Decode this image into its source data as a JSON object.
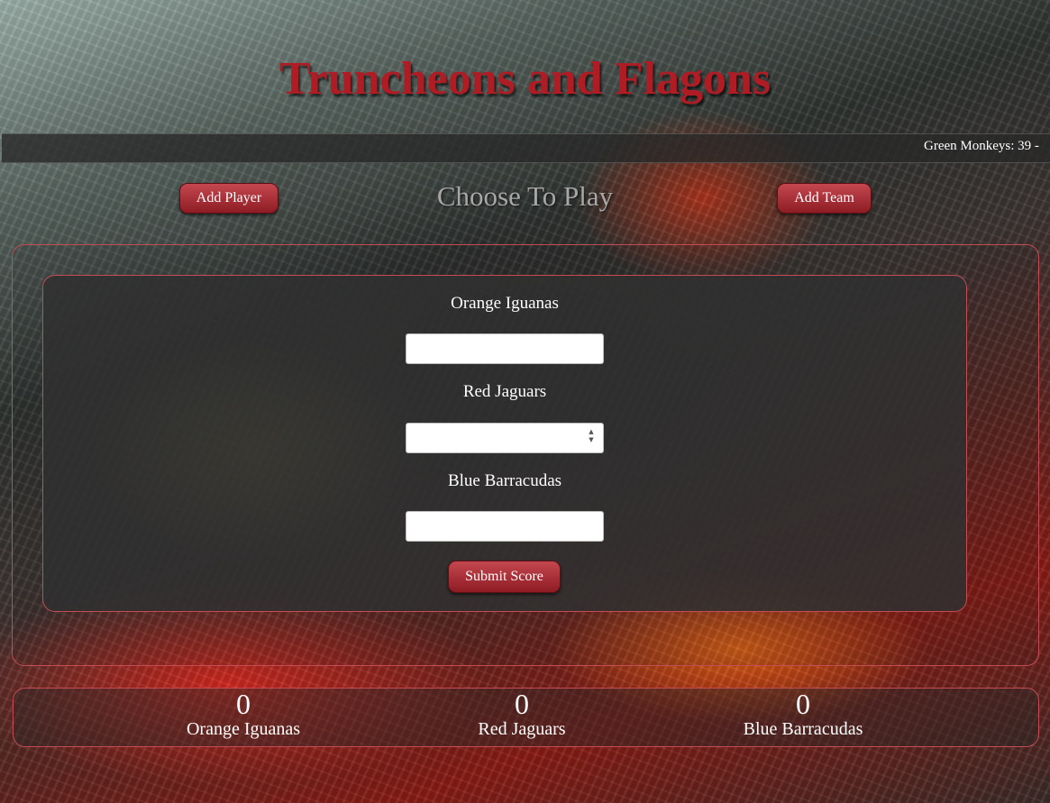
{
  "header": {
    "title": "Truncheons and Flagons"
  },
  "ticker": {
    "text": "Green Monkeys: 39 -"
  },
  "toolbar": {
    "add_player_label": "Add Player",
    "choose_label": "Choose To Play",
    "add_team_label": "Add Team"
  },
  "score_form": {
    "teams": [
      {
        "label": "Orange Iguanas",
        "value": ""
      },
      {
        "label": "Red Jaguars",
        "value": ""
      },
      {
        "label": "Blue Barracudas",
        "value": ""
      }
    ],
    "submit_label": "Submit Score"
  },
  "scoreboard": [
    {
      "score": "0",
      "team": "Orange Iguanas"
    },
    {
      "score": "0",
      "team": "Red Jaguars"
    },
    {
      "score": "0",
      "team": "Blue Barracudas"
    }
  ],
  "colors": {
    "title_red": "#b01c24",
    "button_gradient_top": "#c4474f",
    "button_gradient_bottom": "#8e1c24",
    "panel_border": "#c44d55"
  }
}
